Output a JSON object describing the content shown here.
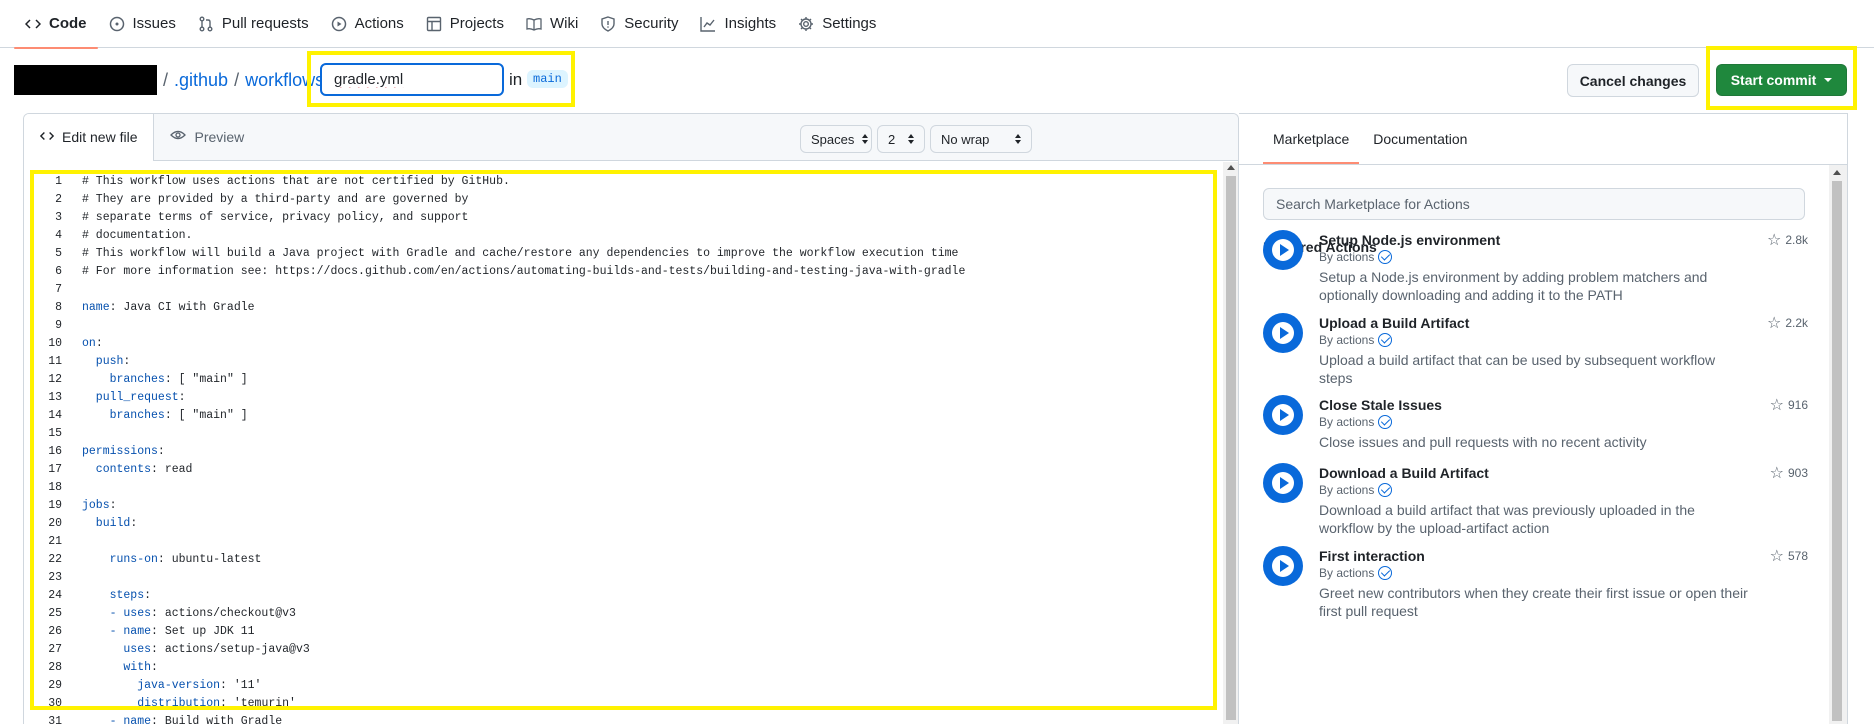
{
  "nav": {
    "tabs": [
      {
        "label": "Code",
        "icon": "code-icon",
        "active": true
      },
      {
        "label": "Issues",
        "icon": "issue-icon",
        "active": false
      },
      {
        "label": "Pull requests",
        "icon": "pull-request-icon",
        "active": false
      },
      {
        "label": "Actions",
        "icon": "play-icon",
        "active": false
      },
      {
        "label": "Projects",
        "icon": "table-icon",
        "active": false
      },
      {
        "label": "Wiki",
        "icon": "book-icon",
        "active": false
      },
      {
        "label": "Security",
        "icon": "shield-icon",
        "active": false
      },
      {
        "label": "Insights",
        "icon": "graph-icon",
        "active": false
      },
      {
        "label": "Settings",
        "icon": "gear-icon",
        "active": false
      }
    ]
  },
  "path": {
    "sep": "/",
    "parts": [
      ".github",
      "workflows"
    ],
    "filename": "gradle.yml",
    "in_label": "in",
    "branch": "main"
  },
  "actions": {
    "cancel_label": "Cancel changes",
    "commit_label": "Start commit"
  },
  "editor": {
    "tab_edit": "Edit new file",
    "tab_preview": "Preview",
    "indent_mode": "Spaces",
    "indent_size": "2",
    "wrap_mode": "No wrap",
    "lines": [
      {
        "n": "1",
        "key": "",
        "text": "# This workflow uses actions that are not certified by GitHub."
      },
      {
        "n": "2",
        "key": "",
        "text": "# They are provided by a third-party and are governed by"
      },
      {
        "n": "3",
        "key": "",
        "text": "# separate terms of service, privacy policy, and support"
      },
      {
        "n": "4",
        "key": "",
        "text": "# documentation."
      },
      {
        "n": "5",
        "key": "",
        "text": "# This workflow will build a Java project with Gradle and cache/restore any dependencies to improve the workflow execution time"
      },
      {
        "n": "6",
        "key": "",
        "text": "# For more information see: https://docs.github.com/en/actions/automating-builds-and-tests/building-and-testing-java-with-gradle"
      },
      {
        "n": "7",
        "key": "",
        "text": ""
      },
      {
        "n": "8",
        "key": "name",
        "text": ": Java CI with Gradle"
      },
      {
        "n": "9",
        "key": "",
        "text": ""
      },
      {
        "n": "10",
        "key": "on",
        "text": ":"
      },
      {
        "n": "11",
        "key": "  push",
        "text": ":"
      },
      {
        "n": "12",
        "key": "    branches",
        "text": ": [ \"main\" ]"
      },
      {
        "n": "13",
        "key": "  pull_request",
        "text": ":"
      },
      {
        "n": "14",
        "key": "    branches",
        "text": ": [ \"main\" ]"
      },
      {
        "n": "15",
        "key": "",
        "text": ""
      },
      {
        "n": "16",
        "key": "permissions",
        "text": ":"
      },
      {
        "n": "17",
        "key": "  contents",
        "text": ": read"
      },
      {
        "n": "18",
        "key": "",
        "text": ""
      },
      {
        "n": "19",
        "key": "jobs",
        "text": ":"
      },
      {
        "n": "20",
        "key": "  build",
        "text": ":"
      },
      {
        "n": "21",
        "key": "",
        "text": ""
      },
      {
        "n": "22",
        "key": "    runs-on",
        "text": ": ubuntu-latest"
      },
      {
        "n": "23",
        "key": "",
        "text": ""
      },
      {
        "n": "24",
        "key": "    steps",
        "text": ":"
      },
      {
        "n": "25",
        "key": "    - uses",
        "text": ": actions/checkout@v3"
      },
      {
        "n": "26",
        "key": "    - name",
        "text": ": Set up JDK 11"
      },
      {
        "n": "27",
        "key": "      uses",
        "text": ": actions/setup-java@v3"
      },
      {
        "n": "28",
        "key": "      with",
        "text": ":"
      },
      {
        "n": "29",
        "key": "        java-version",
        "text": ": '11'"
      },
      {
        "n": "30",
        "key": "        distribution",
        "text": ": 'temurin'"
      },
      {
        "n": "31",
        "key": "    - name",
        "text": ": Build with Gradle"
      }
    ]
  },
  "marketplace": {
    "tab_marketplace": "Marketplace",
    "tab_docs": "Documentation",
    "search_placeholder": "Search Marketplace for Actions",
    "featured_heading": "Featured Actions",
    "items": [
      {
        "title": "Setup Node.js environment",
        "by": "By actions",
        "desc": "Setup a Node.js environment by adding problem matchers and optionally downloading and adding it to the PATH",
        "stars": "2.8k"
      },
      {
        "title": "Upload a Build Artifact",
        "by": "By actions",
        "desc": "Upload a build artifact that can be used by subsequent workflow steps",
        "stars": "2.2k"
      },
      {
        "title": "Close Stale Issues",
        "by": "By actions",
        "desc": "Close issues and pull requests with no recent activity",
        "stars": "916"
      },
      {
        "title": "Download a Build Artifact",
        "by": "By actions",
        "desc": "Download a build artifact that was previously uploaded in the workflow by the upload-artifact action",
        "stars": "903"
      },
      {
        "title": "First interaction",
        "by": "By actions",
        "desc": "Greet new contributors when they create their first issue or open their first pull request",
        "stars": "578"
      }
    ]
  },
  "colors": {
    "accent": "#0969da",
    "commit_green": "#1f883d",
    "highlight": "#fff200",
    "tab_underline": "#fd8c73"
  }
}
